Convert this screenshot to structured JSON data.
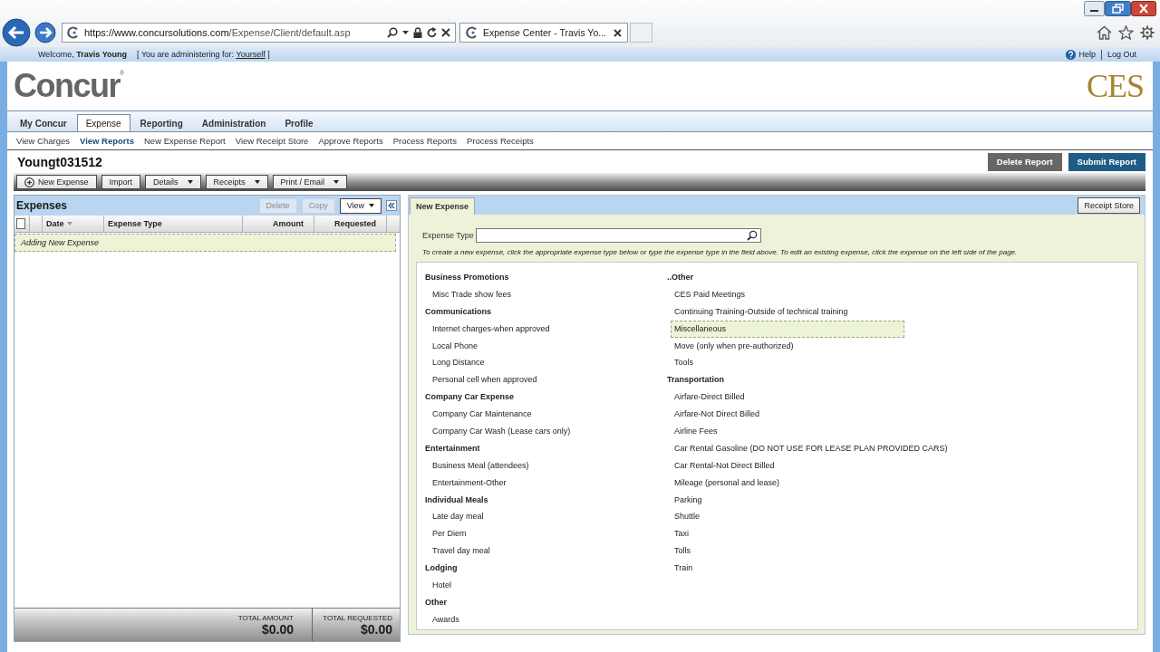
{
  "browser": {
    "url_host": "https://www.concursolutions.com",
    "url_path": "/Expense/Client/default.asp",
    "tab_title": "Expense Center - Travis Yo..."
  },
  "top_bar": {
    "welcome": "Welcome, **Travis Young**",
    "admin_before": "[ You are administering for:",
    "admin_link": "Yourself",
    "admin_after": "]",
    "help": "Help",
    "logout": "Log Out"
  },
  "header": {
    "logo": "Concur",
    "logo_mark": "®",
    "client_logo": "CES"
  },
  "nav_tabs": [
    {
      "label": "My Concur",
      "selected": false
    },
    {
      "label": "Expense",
      "selected": true
    },
    {
      "label": "Reporting",
      "selected": false
    },
    {
      "label": "Administration",
      "selected": false
    },
    {
      "label": "Profile",
      "selected": false
    }
  ],
  "sub_nav": [
    {
      "label": "View Charges",
      "selected": false
    },
    {
      "label": "View Reports",
      "selected": true
    },
    {
      "label": "New Expense Report",
      "selected": false
    },
    {
      "label": "View Receipt Store",
      "selected": false
    },
    {
      "label": "Approve Reports",
      "selected": false
    },
    {
      "label": "Process Reports",
      "selected": false
    },
    {
      "label": "Process Receipts",
      "selected": false
    }
  ],
  "report": {
    "title": "Youngt031512",
    "actions": [
      {
        "label": "Delete Report",
        "kind": "secondary"
      },
      {
        "label": "Submit Report",
        "kind": "primary"
      }
    ]
  },
  "toolbar": [
    {
      "label": "New Expense",
      "kind": "add"
    },
    {
      "label": "Import",
      "kind": "plain"
    },
    {
      "label": "Details",
      "kind": "menu"
    },
    {
      "label": "Receipts",
      "kind": "menu"
    },
    {
      "label": "Print / Email",
      "kind": "menu"
    }
  ],
  "expenses": {
    "title": "Expenses",
    "actions": [
      {
        "label": "Delete",
        "kind": "plain",
        "disabled": true
      },
      {
        "label": "Copy",
        "kind": "plain",
        "disabled": true
      },
      {
        "label": "View",
        "kind": "menu",
        "disabled": false
      }
    ],
    "select_all": {
      "checked": false
    },
    "columns": [
      {
        "label": "Date",
        "kind": "sort"
      },
      {
        "label": "Expense Type",
        "kind": "text"
      },
      {
        "label": "Amount",
        "kind": "number"
      },
      {
        "label": "Requested",
        "kind": "number"
      }
    ],
    "rows": [
      {
        "label": "Adding New Expense",
        "selected": true
      }
    ],
    "totals": [
      {
        "label": "TOTAL AMOUNT",
        "value": "$0.00"
      },
      {
        "label": "TOTAL REQUESTED",
        "value": "$0.00"
      }
    ]
  },
  "new_expense": {
    "tab": {
      "label": "New Expense",
      "selected": true
    },
    "receipt_store": "Receipt Store",
    "field_label": "Expense Type",
    "instructions": "To create a new expense, click the appropriate expense type below or type the expense type in the field above. To edit an existing expense, click the expense on the left side of the page.",
    "columns": [
      [
        {
          "name": "Business Promotions",
          "items": [
            {
              "label": "Misc Trade show fees",
              "selected": false
            }
          ]
        },
        {
          "name": "Communications",
          "items": [
            {
              "label": "Internet charges-when approved",
              "selected": false
            },
            {
              "label": "Local Phone",
              "selected": false
            },
            {
              "label": "Long Distance",
              "selected": false
            },
            {
              "label": "Personal cell when approved",
              "selected": false
            }
          ]
        },
        {
          "name": "Company Car Expense",
          "items": [
            {
              "label": "Company Car Maintenance",
              "selected": false
            },
            {
              "label": "Company Car Wash (Lease cars only)",
              "selected": false
            }
          ]
        },
        {
          "name": "Entertainment",
          "items": [
            {
              "label": "Business Meal (attendees)",
              "selected": false
            },
            {
              "label": "Entertainment-Other",
              "selected": false
            }
          ]
        },
        {
          "name": "Individual Meals",
          "items": [
            {
              "label": "Late day meal",
              "selected": false
            },
            {
              "label": "Per Diem",
              "selected": false
            },
            {
              "label": "Travel day meal",
              "selected": false
            }
          ]
        },
        {
          "name": "Lodging",
          "items": [
            {
              "label": "Hotel",
              "selected": false
            }
          ]
        },
        {
          "name": "Other",
          "items": [
            {
              "label": "Awards",
              "selected": false
            }
          ]
        }
      ],
      [
        {
          "name": "..Other",
          "items": [
            {
              "label": "CES Paid Meetings",
              "selected": false
            },
            {
              "label": "Continuing Training-Outside of technical training",
              "selected": false
            },
            {
              "label": "Miscellaneous",
              "selected": true
            },
            {
              "label": "Move (only when pre-authorized)",
              "selected": false
            },
            {
              "label": "Tools",
              "selected": false
            }
          ]
        },
        {
          "name": "Transportation",
          "items": [
            {
              "label": "Airfare-Direct Billed",
              "selected": false
            },
            {
              "label": "Airfare-Not Direct Billed",
              "selected": false
            },
            {
              "label": "Airline Fees",
              "selected": false
            },
            {
              "label": "Car Rental Gasoline (DO NOT USE FOR LEASE PLAN PROVIDED CARS)",
              "selected": false
            },
            {
              "label": "Car Rental-Not Direct Billed",
              "selected": false
            },
            {
              "label": "Mileage (personal and lease)",
              "selected": false
            },
            {
              "label": "Parking",
              "selected": false
            },
            {
              "label": "Shuttle",
              "selected": false
            },
            {
              "label": "Taxi",
              "selected": false
            },
            {
              "label": "Tolls",
              "selected": false
            },
            {
              "label": "Train",
              "selected": false
            }
          ]
        }
      ]
    ]
  }
}
